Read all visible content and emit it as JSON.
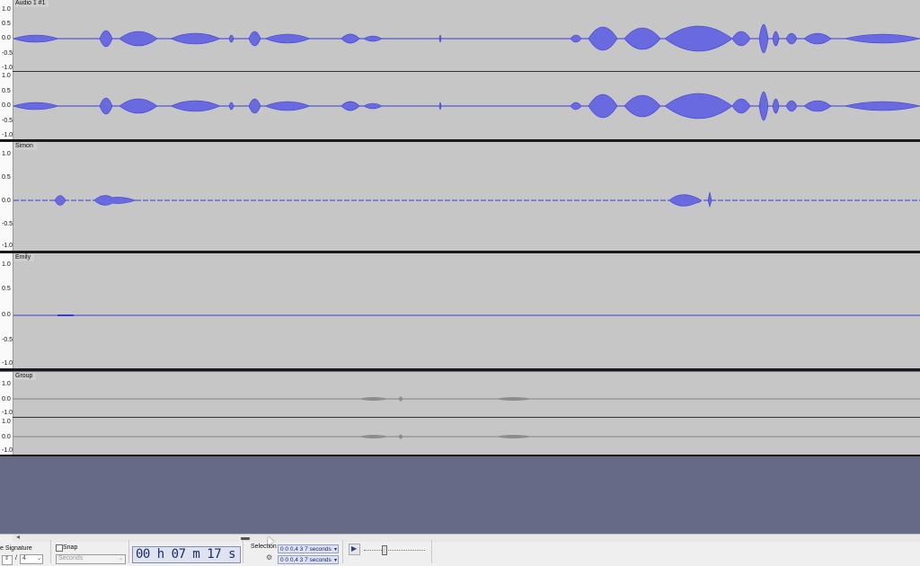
{
  "tracks": [
    {
      "name": "Audio 1 #1",
      "channels": [
        {
          "scale": [
            "1.0",
            "0.5",
            "0.0",
            "-0.5",
            "-1.0"
          ]
        },
        {
          "scale": [
            "1.0",
            "0.5",
            "0.0",
            "-0.5",
            "-1.0"
          ]
        }
      ]
    },
    {
      "name": "Simon",
      "channels": [
        {
          "scale": [
            "1.0",
            "0.5",
            "0.0",
            "-0.5",
            "-1.0"
          ]
        }
      ]
    },
    {
      "name": "Emily",
      "channels": [
        {
          "scale": [
            "1.0",
            "0.5",
            "0.0",
            "-0.5",
            "-1.0"
          ]
        }
      ]
    },
    {
      "name": "Group",
      "channels": [
        {
          "scale": [
            "1.0",
            "0.0",
            "-1.0"
          ]
        },
        {
          "scale": [
            "1.0",
            "0.0",
            "-1.0"
          ]
        }
      ]
    }
  ],
  "colors": {
    "waveform": "#3b3bd6",
    "waveform_fill": "#6a6ae0",
    "track_bg": "#c6c6c6",
    "empty_area": "#656a87",
    "muted_wave": "#808080"
  },
  "toolbar": {
    "time_signature_label": "e Signature",
    "time_signature_denominator": "4",
    "time_signature_slash": "/",
    "snap_label": "Snap",
    "snap_units": "Seconds",
    "time_display": "00 h 07 m 17 s",
    "selection_label": "Selection",
    "selection_start": "0 0 0,4 3 7 seconds",
    "selection_end": "0 0 0,4 3 7 seconds"
  }
}
